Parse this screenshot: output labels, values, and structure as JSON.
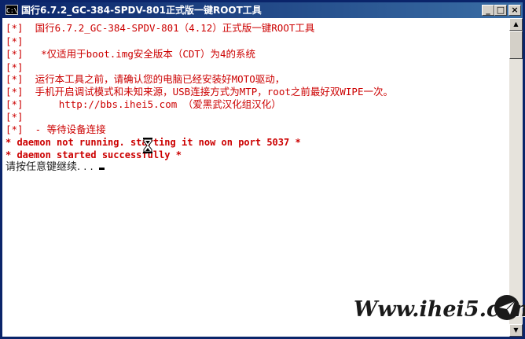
{
  "window": {
    "title": "国行6.7.2_GC-384-SPDV-801正式版一键ROOT工具",
    "icon_label": "C:\\",
    "buttons": {
      "minimize": "_",
      "maximize": "□",
      "close": "×"
    }
  },
  "console": {
    "lines": [
      "[*]  国行6.7.2_GC-384-SPDV-801（4.12）正式版一键ROOT工具",
      "[*]",
      "[*]   *仅适用于boot.img安全版本（CDT）为4的系统",
      "[*]",
      "[*]  运行本工具之前，请确认您的电脑已经安装好MOTO驱动，",
      "[*]  手机开启调试模式和未知来源，USB连接方式为MTP，root之前最好双WIPE一次。",
      "[*]      http://bbs.ihei5.com （爱黑武汉化组汉化）",
      "[*]",
      "[*]  - 等待设备连接",
      "* daemon not running. starting it now on port 5037 *",
      "* daemon started successfully *",
      "请按任意键继续. . . "
    ]
  },
  "cursor_icon": "hourglass-icon",
  "watermark": {
    "text": "Www.ihei5.com",
    "logo": "paper-plane-icon"
  },
  "colors": {
    "titlebar": "#0a246a",
    "console_text": "#cc0000",
    "console_bg": "#ffffff"
  }
}
